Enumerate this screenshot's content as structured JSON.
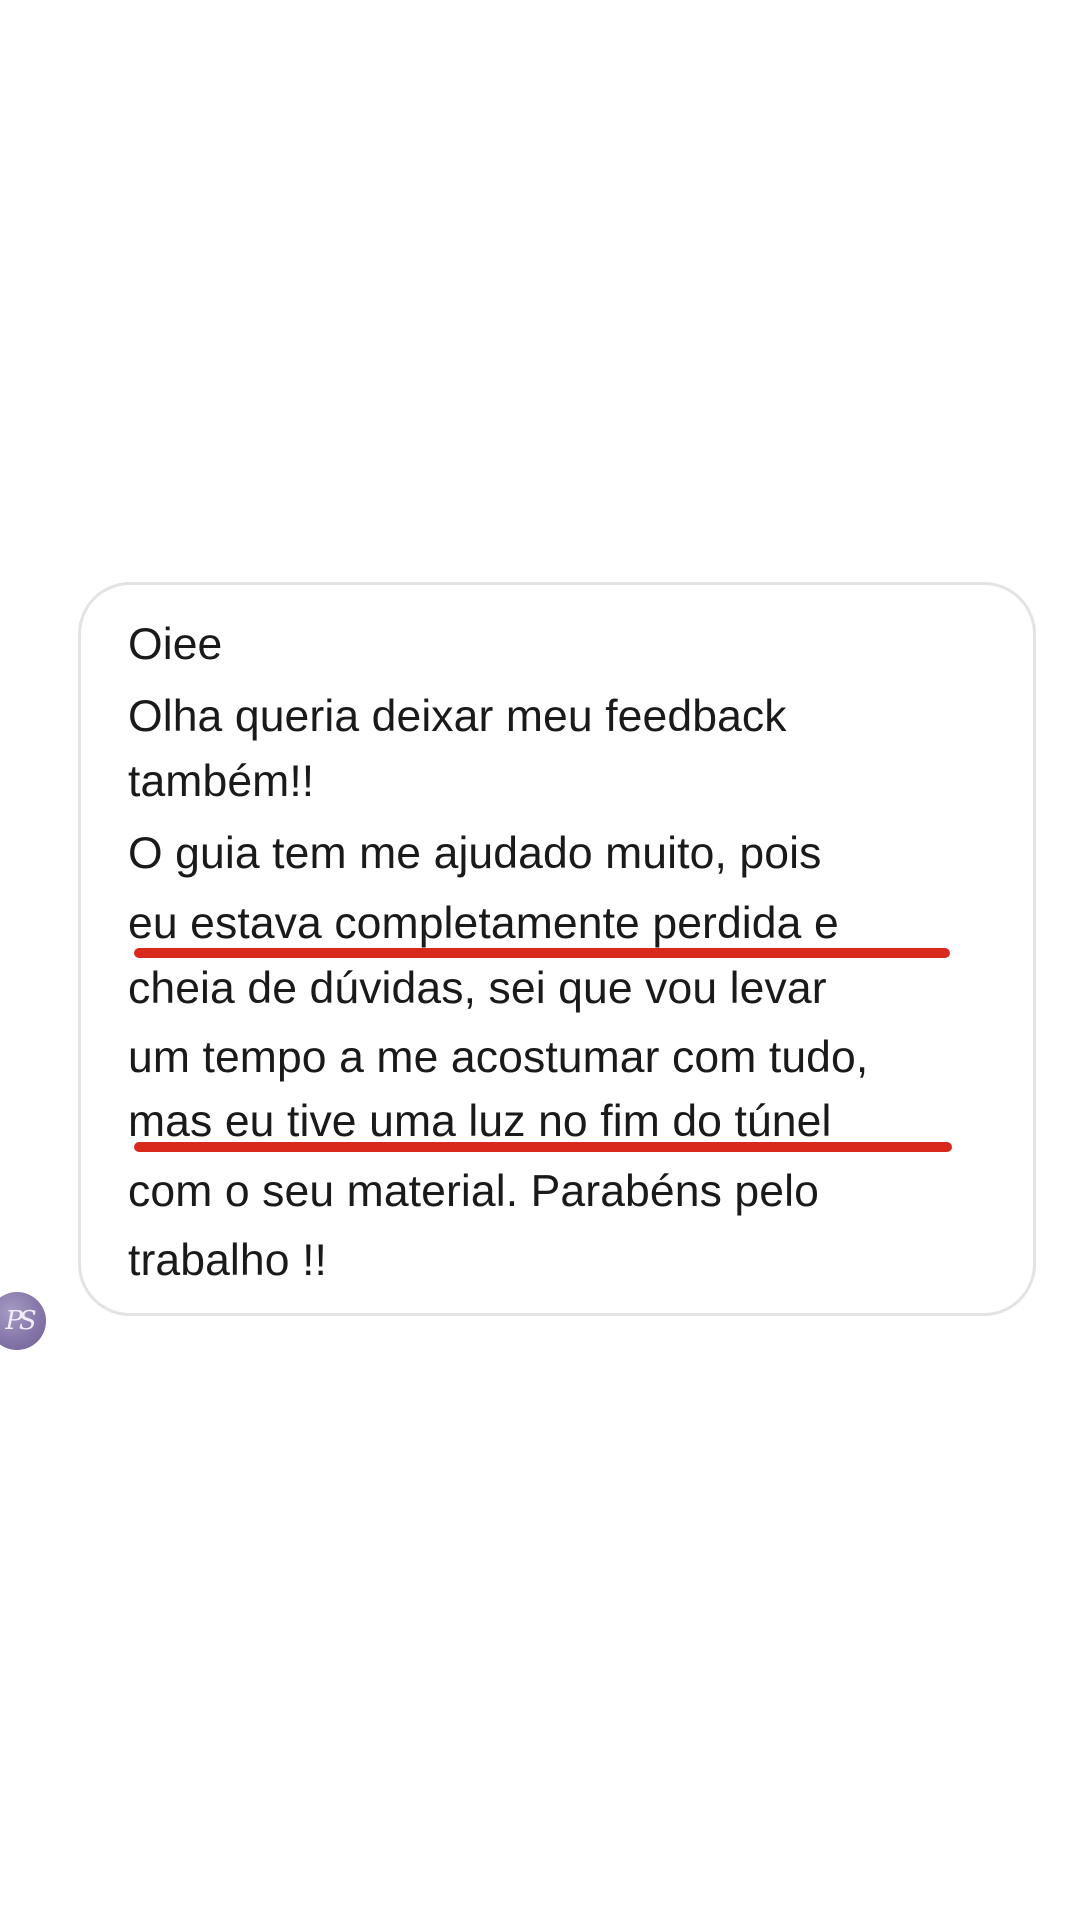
{
  "message": {
    "lines": [
      "Oiee",
      "Olha queria deixar meu feedback",
      "também!!",
      "O guia tem me ajudado muito, pois",
      "eu estava completamente perdida e",
      "cheia de dúvidas, sei que vou levar",
      "um tempo a me acostumar com tudo,",
      "mas eu tive uma luz no fim do túnel",
      "com o seu material. Parabéns pelo",
      "trabalho !!"
    ],
    "highlighted_line_indices": [
      4,
      7
    ],
    "highlight_color": "#d9291c"
  },
  "avatar": {
    "monogram": "PS",
    "color": "#8676a9"
  },
  "colors": {
    "background": "#ffffff",
    "bubble_border": "#e3e3e3",
    "text": "#1a1a1a"
  }
}
